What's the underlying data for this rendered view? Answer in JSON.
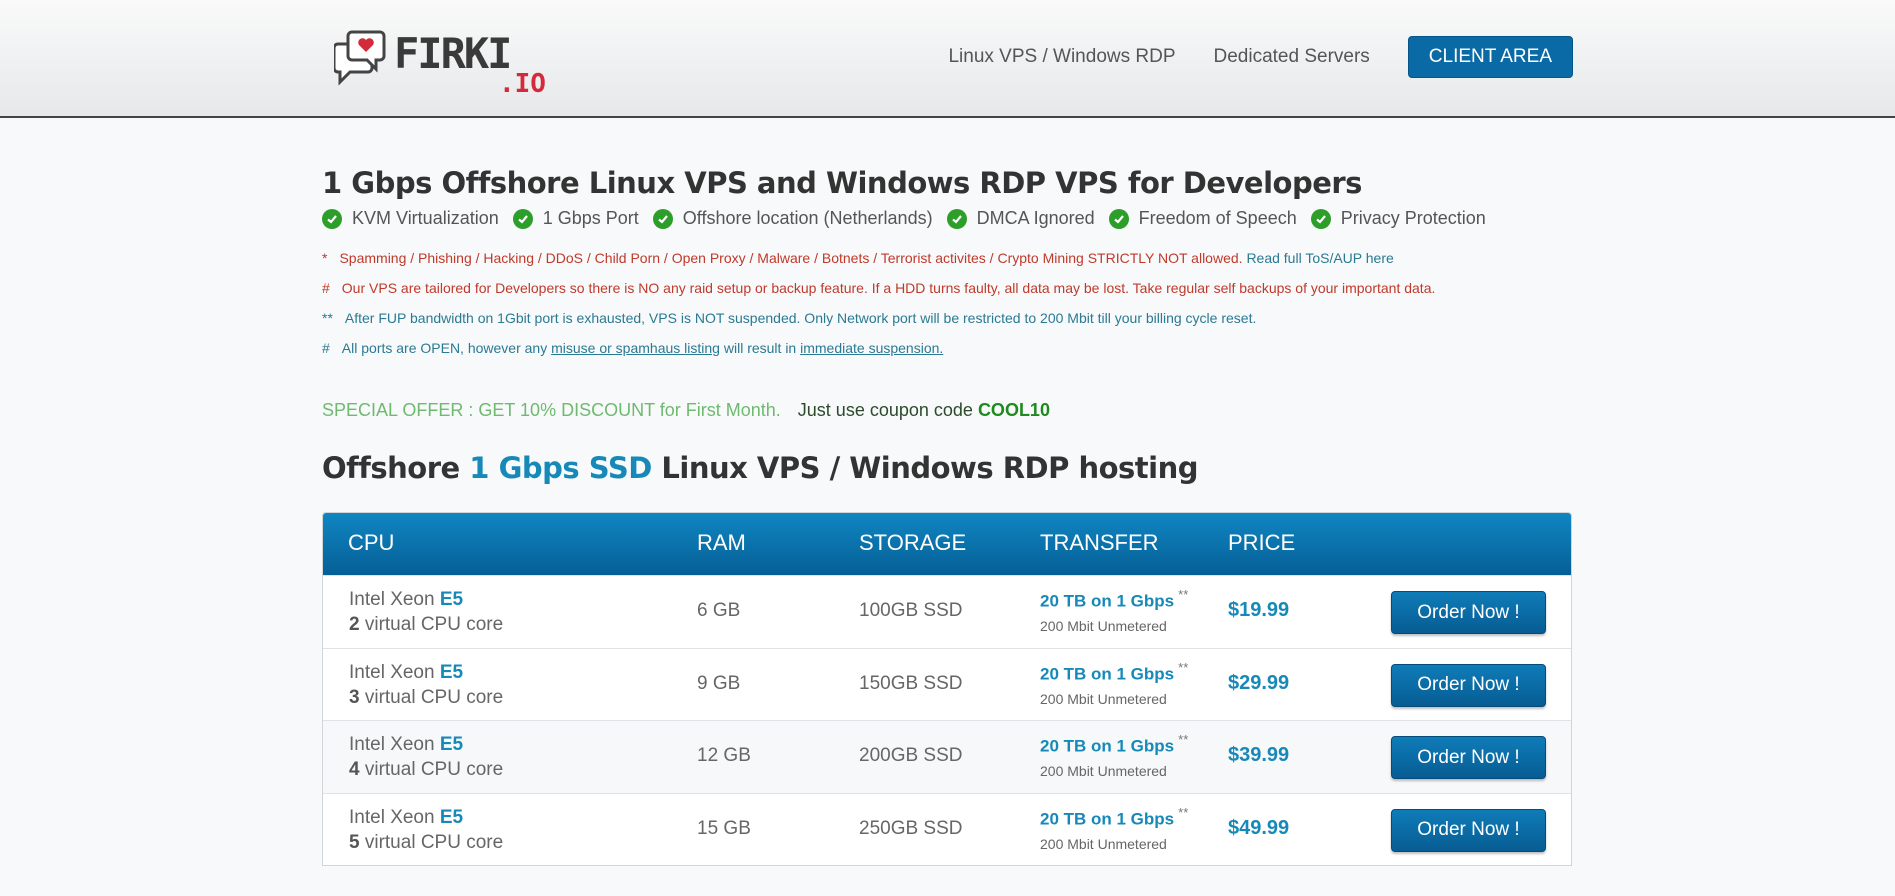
{
  "brand": {
    "name": "FIRKI",
    "tld": ".IO",
    "icon": "chat-heart-icon"
  },
  "nav": {
    "items": [
      "Linux VPS / Windows RDP",
      "Dedicated Servers"
    ],
    "client_area": "CLIENT AREA"
  },
  "main": {
    "title": "1 Gbps Offshore Linux VPS and Windows RDP VPS for Developers",
    "features": [
      "KVM Virtualization",
      "1 Gbps Port",
      "Offshore location (Netherlands)",
      "DMCA Ignored",
      "Freedom of Speech",
      "Privacy Protection"
    ],
    "notes": {
      "n1_mark": "*",
      "n1_text": "Spamming / Phishing / Hacking / DDoS / Child Porn / Open Proxy / Malware / Botnets / Terrorist activites / Crypto Mining STRICTLY NOT allowed.",
      "n1_link": "Read full ToS/AUP here",
      "n2_mark": "#",
      "n2_text": "Our VPS are tailored for Developers so there is NO any raid setup or backup feature. If a HDD turns faulty, all data may be lost. Take regular self backups of your important data.",
      "n3_mark": "**",
      "n3_text": "After FUP bandwidth on 1Gbit port is exhausted, VPS is NOT suspended. Only Network port will be restricted to 200 Mbit till your billing cycle reset.",
      "n4_mark": "#",
      "n4_pre": "All ports are OPEN, however any",
      "n4_link1": "misuse or spamhaus listing",
      "n4_mid": "will result in",
      "n4_link2": "immediate suspension."
    },
    "offer": {
      "text": "SPECIAL OFFER : GET 10% DISCOUNT for First Month.",
      "coupon_label": "Just use coupon code",
      "code": "COOL10"
    },
    "section_title": {
      "pre": "Offshore",
      "accent": "1 Gbps SSD",
      "post": "Linux VPS / Windows RDP hosting"
    }
  },
  "table": {
    "headers": {
      "cpu": "CPU",
      "ram": "RAM",
      "storage": "STORAGE",
      "transfer": "TRANSFER",
      "price": "PRICE"
    },
    "rows": [
      {
        "cpu_model": "Intel Xeon",
        "cpu_gen": "E5",
        "cores": "2",
        "cores_label": "virtual CPU core",
        "ram": "6 GB",
        "storage": "100GB SSD",
        "transfer": "20 TB on 1 Gbps",
        "transfer_mark": "**",
        "transfer_sub": "200 Mbit Unmetered",
        "price": "$19.99",
        "order": "Order Now !"
      },
      {
        "cpu_model": "Intel Xeon",
        "cpu_gen": "E5",
        "cores": "3",
        "cores_label": "virtual CPU core",
        "ram": "9 GB",
        "storage": "150GB SSD",
        "transfer": "20 TB on 1 Gbps",
        "transfer_mark": "**",
        "transfer_sub": "200 Mbit Unmetered",
        "price": "$29.99",
        "order": "Order Now !"
      },
      {
        "cpu_model": "Intel Xeon",
        "cpu_gen": "E5",
        "cores": "4",
        "cores_label": "virtual CPU core",
        "ram": "12 GB",
        "storage": "200GB SSD",
        "transfer": "20 TB on 1 Gbps",
        "transfer_mark": "**",
        "transfer_sub": "200 Mbit Unmetered",
        "price": "$39.99",
        "order": "Order Now !"
      },
      {
        "cpu_model": "Intel Xeon",
        "cpu_gen": "E5",
        "cores": "5",
        "cores_label": "virtual CPU core",
        "ram": "15 GB",
        "storage": "250GB SSD",
        "transfer": "20 TB on 1 Gbps",
        "transfer_mark": "**",
        "transfer_sub": "200 Mbit Unmetered",
        "price": "$49.99",
        "order": "Order Now !"
      }
    ]
  },
  "colors": {
    "accent": "#1789b8",
    "header_bar": "#0a6aa6",
    "check": "#2e9e2b",
    "warning": "#c03a2b"
  }
}
